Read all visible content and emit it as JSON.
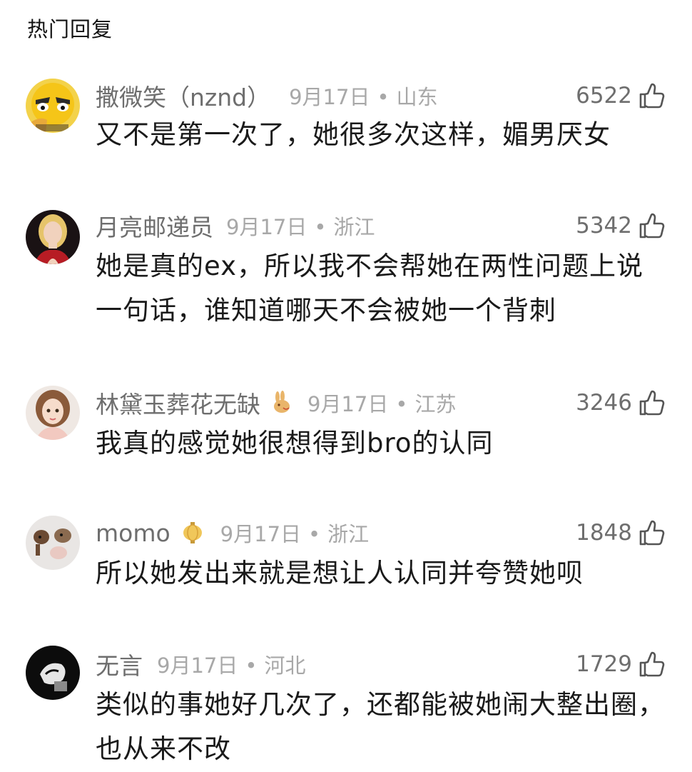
{
  "section": {
    "title": "热门回复"
  },
  "comments": [
    {
      "username": "撒微笑（nznd）",
      "date": "9月17日",
      "location": "山东",
      "likes": "6522",
      "text": "又不是第一次了，她很多次这样，媚男厌女",
      "avatar_icon": "emoji-avatar-icon"
    },
    {
      "username": "月亮邮递员",
      "date": "9月17日",
      "location": "浙江",
      "likes": "5342",
      "text": "她是真的ex，所以我不会帮她在两性问题上说一句话，谁知道哪天不会被她一个背刺",
      "avatar_icon": "woman-photo-avatar-icon"
    },
    {
      "username": "林黛玉葬花无缺",
      "badge_icon": "rabbit-badge-icon",
      "date": "9月17日",
      "location": "江苏",
      "likes": "3246",
      "text": "我真的感觉她很想得到bro的认同",
      "avatar_icon": "cartoon-girl-avatar-icon"
    },
    {
      "username": "momo",
      "badge_icon": "lantern-badge-icon",
      "date": "9月17日",
      "location": "浙江",
      "likes": "1848",
      "text": "所以她发出来就是想让人认同并夸赞她呗",
      "avatar_icon": "dogs-avatar-icon"
    },
    {
      "username": "无言",
      "date": "9月17日",
      "location": "河北",
      "likes": "1729",
      "text": "类似的事她好几次了，还都能被她闹大整出圈，也从来不改",
      "avatar_icon": "dark-avatar-icon"
    }
  ],
  "separator": "•"
}
